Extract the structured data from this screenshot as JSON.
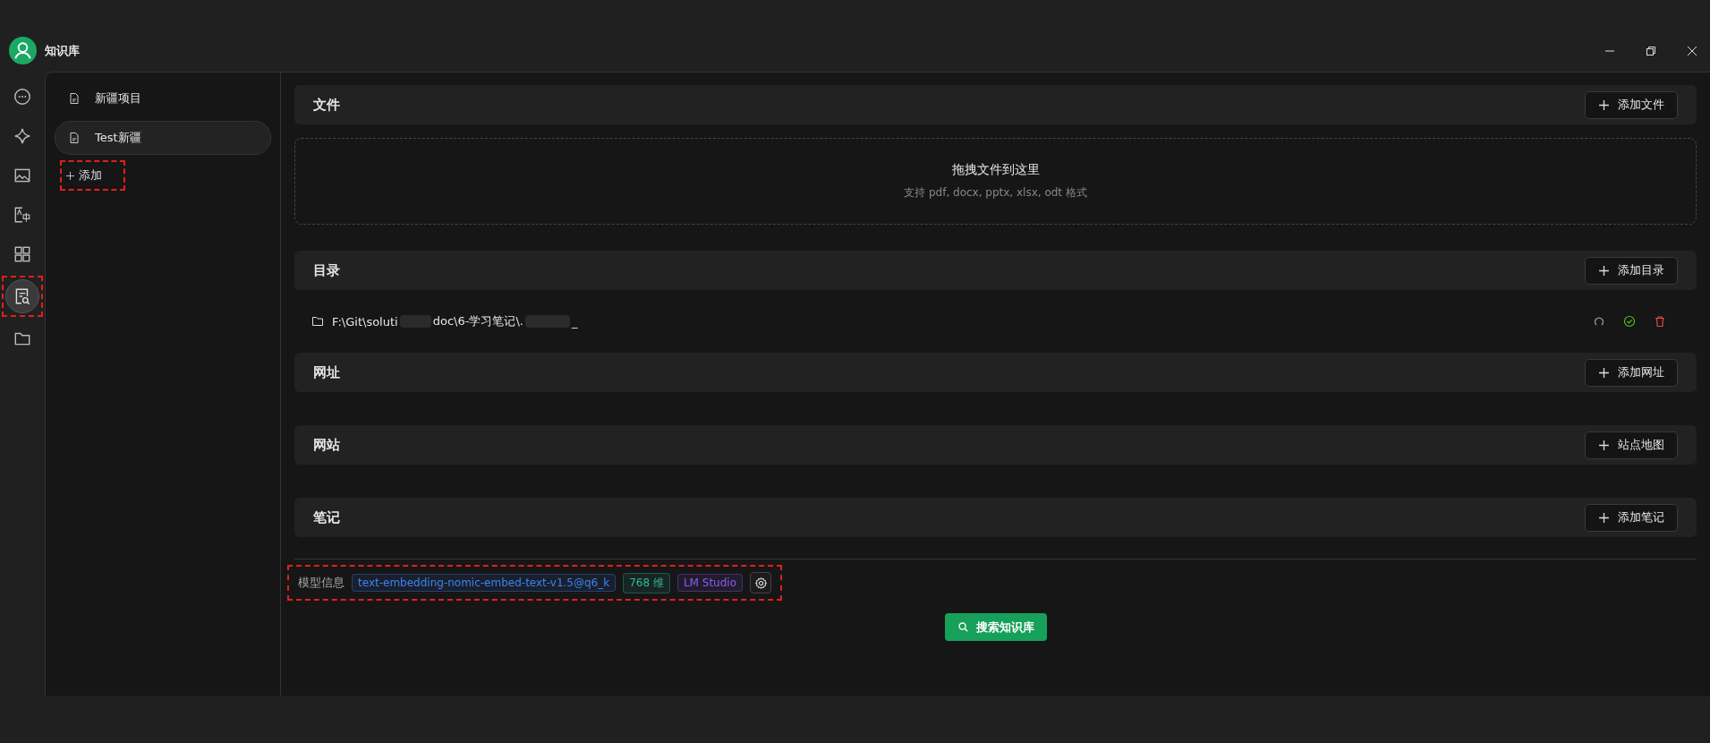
{
  "window": {
    "title": "知识库"
  },
  "nav": [
    {
      "selected": false
    },
    {
      "selected": false
    },
    {
      "selected": false
    },
    {
      "selected": false
    },
    {
      "selected": false
    },
    {
      "selected": true,
      "highlighted": true
    },
    {
      "selected": false
    }
  ],
  "bases": [
    {
      "name": "新疆项目",
      "selected": false
    },
    {
      "name": "Test新疆",
      "selected": true
    }
  ],
  "add_base": {
    "label": "添加",
    "highlighted": true
  },
  "sections": [
    {
      "kind": "files",
      "title": "文件",
      "button": "添加文件",
      "drop_title": "拖拽文件到这里",
      "drop_hint": "支持 pdf, docx, pptx, xlsx, odt 格式"
    },
    {
      "kind": "dirs",
      "title": "目录",
      "button": "添加目录",
      "items": [
        {
          "path_start": "F:\\Git\\soluti",
          "path_middle": "doc\\6-学习笔记\\.",
          "path_end": "_"
        }
      ]
    },
    {
      "kind": "plain",
      "title": "网址",
      "button": "添加网址"
    },
    {
      "kind": "plain",
      "title": "网站",
      "button": "站点地图"
    },
    {
      "kind": "plain",
      "title": "笔记",
      "button": "添加笔记"
    }
  ],
  "model_info": {
    "label": "模型信息",
    "highlighted": true,
    "tags": [
      {
        "text": "text-embedding-nomic-embed-text-v1.5@q6_k",
        "color": "#3b82f6"
      },
      {
        "text": "768 维",
        "color": "#2fb99a"
      },
      {
        "text": "LM Studio",
        "color": "#8b5cf6"
      }
    ]
  },
  "search_button": "搜索知识库"
}
